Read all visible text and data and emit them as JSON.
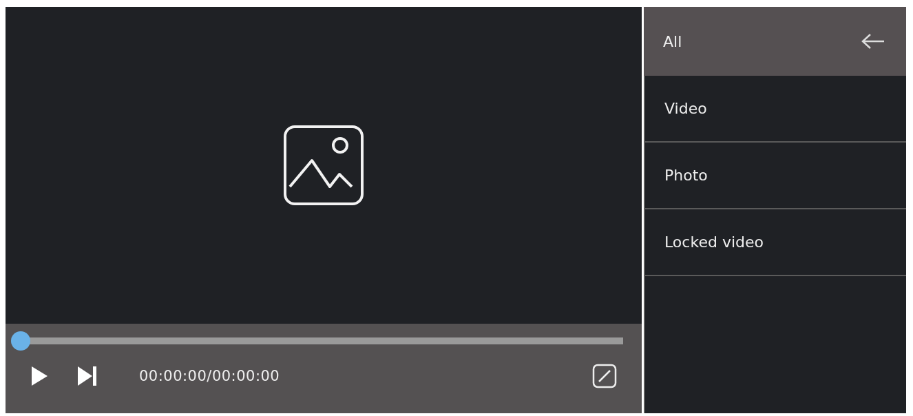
{
  "player": {
    "progress": {
      "level": 0
    },
    "time": "00:00:00/00:00:00"
  },
  "sidebar": {
    "items": [
      {
        "label": "All",
        "selected": true
      },
      {
        "label": "Video",
        "selected": false
      },
      {
        "label": "Photo",
        "selected": false
      },
      {
        "label": "Locked video",
        "selected": false
      }
    ]
  }
}
